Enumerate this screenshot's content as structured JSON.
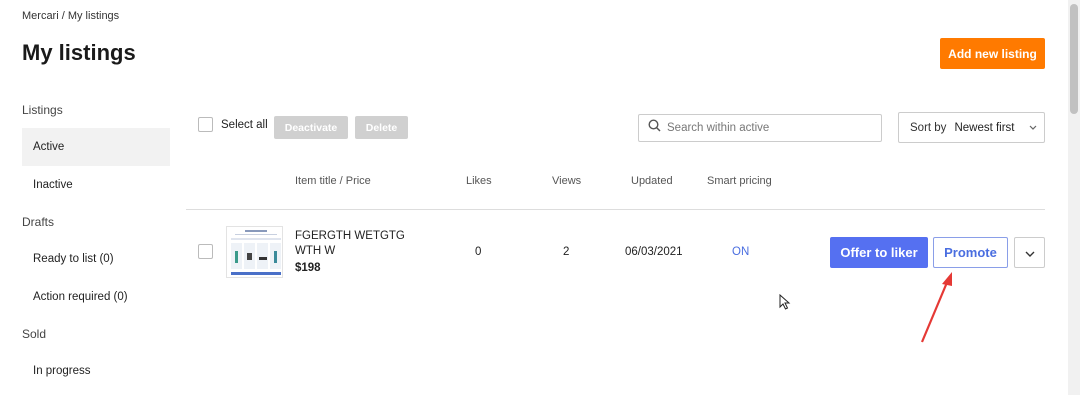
{
  "breadcrumb": "Mercari / My listings",
  "page_title": "My listings",
  "add_button": "Add new listing",
  "sidebar": {
    "sections": [
      {
        "label": "Listings",
        "items": [
          {
            "label": "Active",
            "active": true
          },
          {
            "label": "Inactive"
          }
        ]
      },
      {
        "label": "Drafts",
        "items": [
          {
            "label": "Ready to list (0)"
          },
          {
            "label": "Action required (0)"
          }
        ]
      },
      {
        "label": "Sold",
        "items": [
          {
            "label": "In progress"
          }
        ]
      }
    ]
  },
  "toolbar": {
    "select_all": "Select all",
    "deactivate": "Deactivate",
    "delete": "Delete",
    "search_placeholder": "Search within active",
    "sort_label": "Sort by",
    "sort_value": "Newest first"
  },
  "table": {
    "headers": [
      "Item title / Price",
      "Likes",
      "Views",
      "Updated",
      "Smart pricing"
    ],
    "rows": [
      {
        "title": "FGERGTH WETGTG WTH W",
        "price": "$198",
        "likes": "0",
        "views": "2",
        "updated": "06/03/2021",
        "smart_pricing": "ON",
        "offer_button": "Offer to liker",
        "promote_button": "Promote"
      }
    ]
  },
  "colors": {
    "accent_orange": "#ff7a00",
    "primary_blue": "#5570f1",
    "annotation_red": "#e53935"
  },
  "icons": [
    "search-icon",
    "chevron-down-icon",
    "mouse-cursor-icon",
    "red-arrow-annotation"
  ]
}
